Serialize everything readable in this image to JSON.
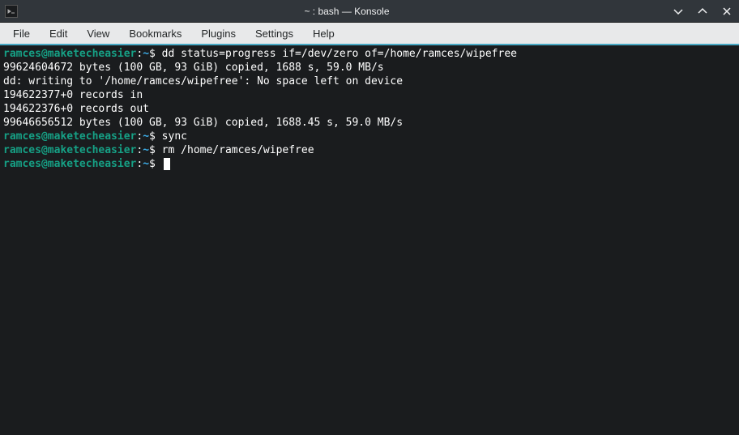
{
  "titlebar": {
    "title": "~ : bash — Konsole"
  },
  "menubar": {
    "items": [
      "File",
      "Edit",
      "View",
      "Bookmarks",
      "Plugins",
      "Settings",
      "Help"
    ]
  },
  "prompt": {
    "userhost": "ramces@maketecheasier",
    "colon": ":",
    "path": "~",
    "dollar": "$"
  },
  "terminal": {
    "lines": [
      {
        "type": "prompt",
        "cmd": " dd status=progress if=/dev/zero of=/home/ramces/wipefree"
      },
      {
        "type": "output",
        "text": "99624604672 bytes (100 GB, 93 GiB) copied, 1688 s, 59.0 MB/s"
      },
      {
        "type": "output",
        "text": "dd: writing to '/home/ramces/wipefree': No space left on device"
      },
      {
        "type": "output",
        "text": "194622377+0 records in"
      },
      {
        "type": "output",
        "text": "194622376+0 records out"
      },
      {
        "type": "output",
        "text": "99646656512 bytes (100 GB, 93 GiB) copied, 1688.45 s, 59.0 MB/s"
      },
      {
        "type": "prompt",
        "cmd": " sync"
      },
      {
        "type": "prompt",
        "cmd": " rm /home/ramces/wipefree"
      },
      {
        "type": "prompt",
        "cmd": " ",
        "cursor": true
      }
    ]
  }
}
